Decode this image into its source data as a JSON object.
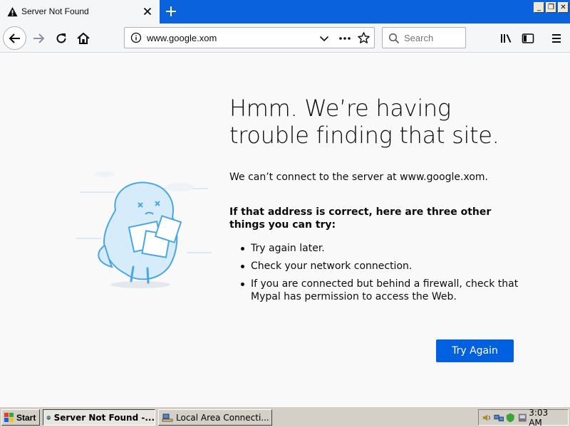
{
  "tab": {
    "title": "Server Not Found",
    "new_tab_icon": "plus-icon",
    "close_icon": "close-icon"
  },
  "window": {
    "minimize": "_",
    "restore": "❐",
    "close": "✕"
  },
  "navbar": {
    "url": "www.google.xom",
    "search_placeholder": "Search"
  },
  "error_page": {
    "heading": "Hmm. We’re having trouble finding that site.",
    "message": "We can’t connect to the server at www.google.xom.",
    "subheading": "If that address is correct, here are three other things you can try:",
    "tips": [
      "Try again later.",
      "Check your network connection.",
      "If you are connected but behind a firewall, check that Mypal has permission to access the Web."
    ],
    "button_label": "Try Again"
  },
  "taskbar": {
    "start_label": "Start",
    "items": [
      {
        "label": "Server Not Found -..."
      },
      {
        "label": "Local Area Connecti..."
      }
    ],
    "clock": "3:03 AM"
  },
  "colors": {
    "tabstrip": "#0a63dd",
    "primary_button": "#0060df",
    "page_background": "#f9f9fa"
  }
}
